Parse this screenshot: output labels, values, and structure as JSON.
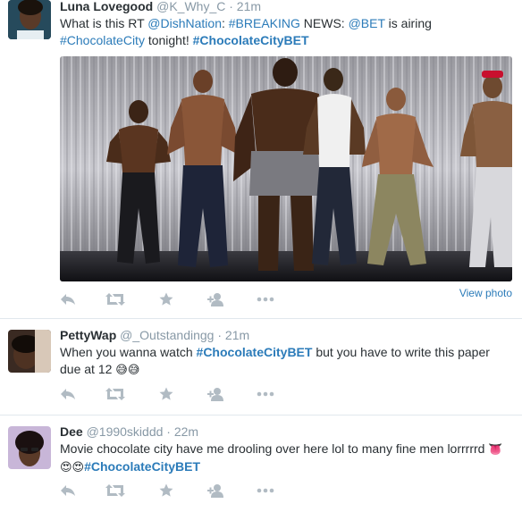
{
  "tweets": [
    {
      "fullname": "Luna Lovegood",
      "username": "@K_Why_C",
      "dot": "·",
      "time": "21m",
      "text": [
        {
          "t": "What is this RT "
        },
        {
          "t": "@DishNation",
          "link": true
        },
        {
          "t": ": "
        },
        {
          "t": "#BREAKING",
          "link": true
        },
        {
          "t": " NEWS: "
        },
        {
          "t": "@BET",
          "link": true
        },
        {
          "t": " is airing "
        },
        {
          "t": "#ChocolateCity",
          "link": true
        },
        {
          "t": " tonight! "
        },
        {
          "t": "#ChocolateCityBET",
          "link": true,
          "bold": true
        }
      ],
      "view_photo": "View photo",
      "photo_icon": "stage-performers-photo"
    },
    {
      "fullname": "PettyWap",
      "username": "@_Outstandingg",
      "dot": "·",
      "time": "21m",
      "text": [
        {
          "t": "When you wanna watch "
        },
        {
          "t": "#ChocolateCityBET",
          "link": true,
          "bold": true
        },
        {
          "t": " but you have to write this paper due at 12 "
        },
        {
          "t": "😅😅",
          "emoji": true
        }
      ]
    },
    {
      "fullname": "Dee",
      "username": "@1990skiddd",
      "dot": "·",
      "time": "22m",
      "text": [
        {
          "t": "Movie chocolate city have me drooling over here lol to many fine men lorrrrrd "
        },
        {
          "t": "👅😍😍",
          "emoji": true
        },
        {
          "t": "#ChocolateCityBET",
          "link": true,
          "bold": true
        }
      ]
    }
  ],
  "action_icons": [
    "reply-icon",
    "retweet-icon",
    "favorite-icon",
    "follow-icon",
    "more-icon"
  ],
  "colors": {
    "link": "#2b7bb9",
    "meta": "#8899a6",
    "icon": "#b1bbc3",
    "divider": "#e1e8ed"
  }
}
